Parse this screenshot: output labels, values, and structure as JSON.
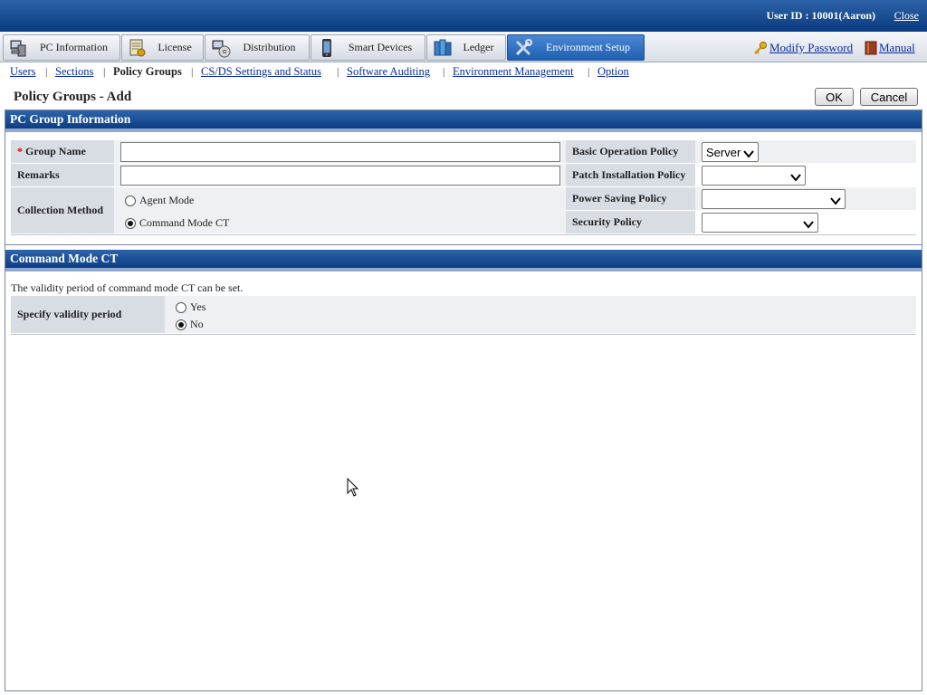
{
  "header": {
    "user_id": "User ID : 10001(Aaron)",
    "close_label": "Close"
  },
  "tabs": [
    {
      "label": "PC Information",
      "icon": "pc-icon"
    },
    {
      "label": "License",
      "icon": "license-icon"
    },
    {
      "label": "Distribution",
      "icon": "distribution-icon"
    },
    {
      "label": "Smart Devices",
      "icon": "smartphone-icon"
    },
    {
      "label": "Ledger",
      "icon": "ledger-icon"
    },
    {
      "label": "Environment Setup",
      "icon": "tools-icon",
      "active": true
    }
  ],
  "header_links": {
    "modify_password": "Modify Password",
    "manual": "Manual"
  },
  "subnav": [
    "Users",
    "Sections",
    "Policy Groups",
    "CS/DS Settings and Status",
    "Software Auditing",
    "Environment Management",
    "Option"
  ],
  "page": {
    "title": "Policy Groups - Add",
    "ok_label": "OK",
    "cancel_label": "Cancel"
  },
  "pc_group": {
    "section_title": "PC Group Information",
    "required_mark": "*",
    "group_name_label": "Group Name",
    "group_name_value": "",
    "remarks_label": "Remarks",
    "remarks_value": "",
    "collection_method_label": "Collection Method",
    "agent_mode_label": "Agent Mode",
    "command_mode_label": "Command Mode CT",
    "collection_selected": "Command Mode CT",
    "basic_policy_label": "Basic Operation Policy",
    "basic_policy_value": "Server",
    "patch_policy_label": "Patch Installation Policy",
    "patch_policy_value": "",
    "power_policy_label": "Power Saving Policy",
    "power_policy_value": "",
    "security_policy_label": "Security Policy",
    "security_policy_value": ""
  },
  "command_mode": {
    "section_title": "Command Mode CT",
    "description": "The validity period of command mode CT can be set.",
    "validity_label": "Specify validity period",
    "yes_label": "Yes",
    "no_label": "No",
    "selected": "No"
  },
  "colors": {
    "header_blue": "#0b3a80",
    "active_tab": "#1f5fb0",
    "link": "#0a2c9b",
    "required": "#dd0000"
  }
}
